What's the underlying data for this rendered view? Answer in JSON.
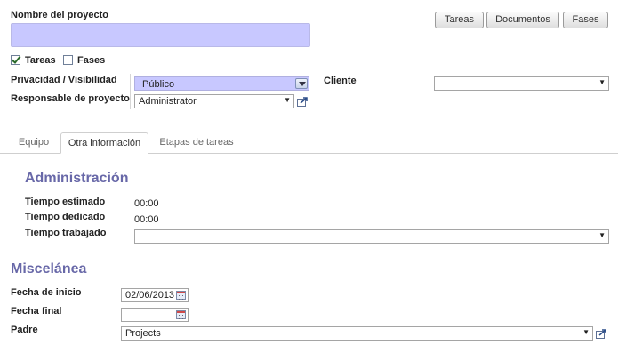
{
  "header": {
    "project_name_label": "Nombre del proyecto",
    "project_name_value": ""
  },
  "top_buttons": [
    "Tareas",
    "Documentos",
    "Fases"
  ],
  "checkboxes": {
    "tareas": {
      "label": "Tareas",
      "checked": true
    },
    "fases": {
      "label": "Fases",
      "checked": false
    }
  },
  "privacy": {
    "label": "Privacidad / Visibilidad",
    "value": "Público"
  },
  "manager": {
    "label": "Responsable de proyecto",
    "value": "Administrator"
  },
  "client": {
    "label": "Cliente",
    "value": ""
  },
  "tabs": [
    {
      "label": "Equipo",
      "active": false
    },
    {
      "label": "Otra información",
      "active": true
    },
    {
      "label": "Etapas de tareas",
      "active": false
    }
  ],
  "administracion": {
    "title": "Administración",
    "estimated": {
      "label": "Tiempo estimado",
      "value": "00:00"
    },
    "spent": {
      "label": "Tiempo dedicado",
      "value": "00:00"
    },
    "worked": {
      "label": "Tiempo trabajado",
      "value": ""
    }
  },
  "miscelanea": {
    "title": "Miscelánea",
    "start_date": {
      "label": "Fecha de inicio",
      "value": "02/06/2013"
    },
    "end_date": {
      "label": "Fecha final",
      "value": ""
    },
    "parent": {
      "label": "Padre",
      "value": "Projects"
    }
  },
  "colors": {
    "accent_purple": "#6868a8",
    "input_highlight": "#c8c8ff"
  },
  "icons": [
    "external-link-icon",
    "calendar-icon",
    "dropdown-arrow-icon",
    "checkmark-icon"
  ]
}
